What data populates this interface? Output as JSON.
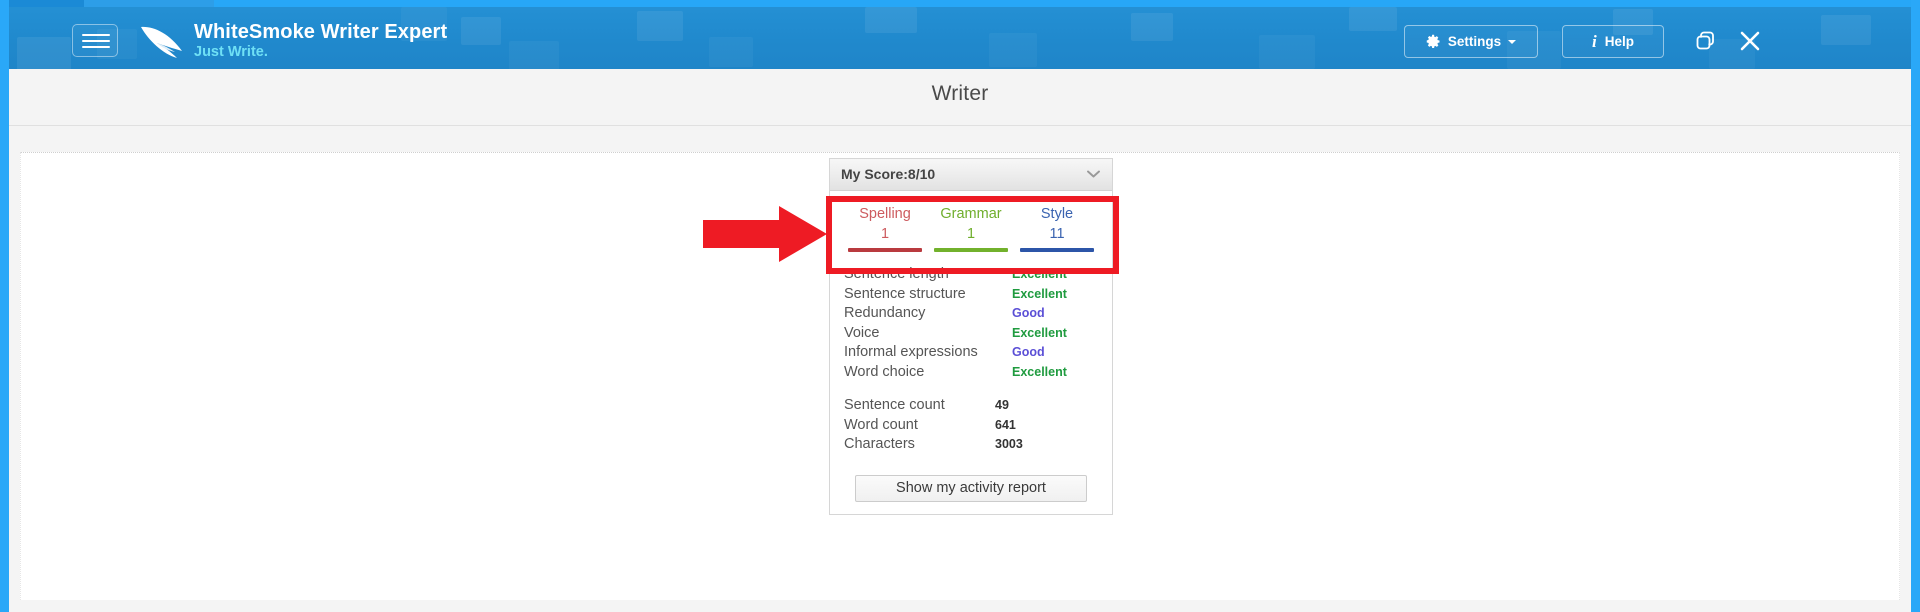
{
  "window": {
    "accent_color": "#27a7f8",
    "header_bg": "#2089cd"
  },
  "header": {
    "menu_icon": "hamburger-menu-icon",
    "brand_icon": "quill-feather-icon",
    "app_title": "WhiteSmoke Writer Expert",
    "app_tagline": "Just Write.",
    "settings_label": "Settings",
    "settings_icon": "gear-icon",
    "settings_caret_icon": "chevron-down-icon",
    "help_label": "Help",
    "help_icon": "info-italic-icon",
    "restore_icon": "restore-window-icon",
    "close_icon": "close-x-icon"
  },
  "page": {
    "title": "Writer"
  },
  "score_panel": {
    "title": "My Score:8/10",
    "collapse_icon": "chevron-down-icon",
    "categories": [
      {
        "name": "Spelling",
        "count": "1",
        "color": "#b93a3f",
        "text_color": "#cd5b5f"
      },
      {
        "name": "Grammar",
        "count": "1",
        "color": "#72b12c",
        "text_color": "#6fae2c"
      },
      {
        "name": "Style",
        "count": "11",
        "color": "#2c55a8",
        "text_color": "#3a63b0"
      }
    ],
    "metrics": [
      {
        "label": "Sentence length",
        "value": "Excellent",
        "rating": "excellent"
      },
      {
        "label": "Sentence structure",
        "value": "Excellent",
        "rating": "excellent"
      },
      {
        "label": "Redundancy",
        "value": "Good",
        "rating": "good"
      },
      {
        "label": "Voice",
        "value": "Excellent",
        "rating": "excellent"
      },
      {
        "label": "Informal expressions",
        "value": "Good",
        "rating": "good"
      },
      {
        "label": "Word choice",
        "value": "Excellent",
        "rating": "excellent"
      }
    ],
    "counts": [
      {
        "label": "Sentence count",
        "value": "49"
      },
      {
        "label": "Word count",
        "value": "641"
      },
      {
        "label": "Characters",
        "value": "3003"
      }
    ],
    "activity_report_label": "Show my activity report"
  },
  "annotation": {
    "color": "#ee1b24",
    "arrow_icon": "right-arrow-annotation-icon",
    "box_icon": "highlight-box-annotation-icon"
  }
}
